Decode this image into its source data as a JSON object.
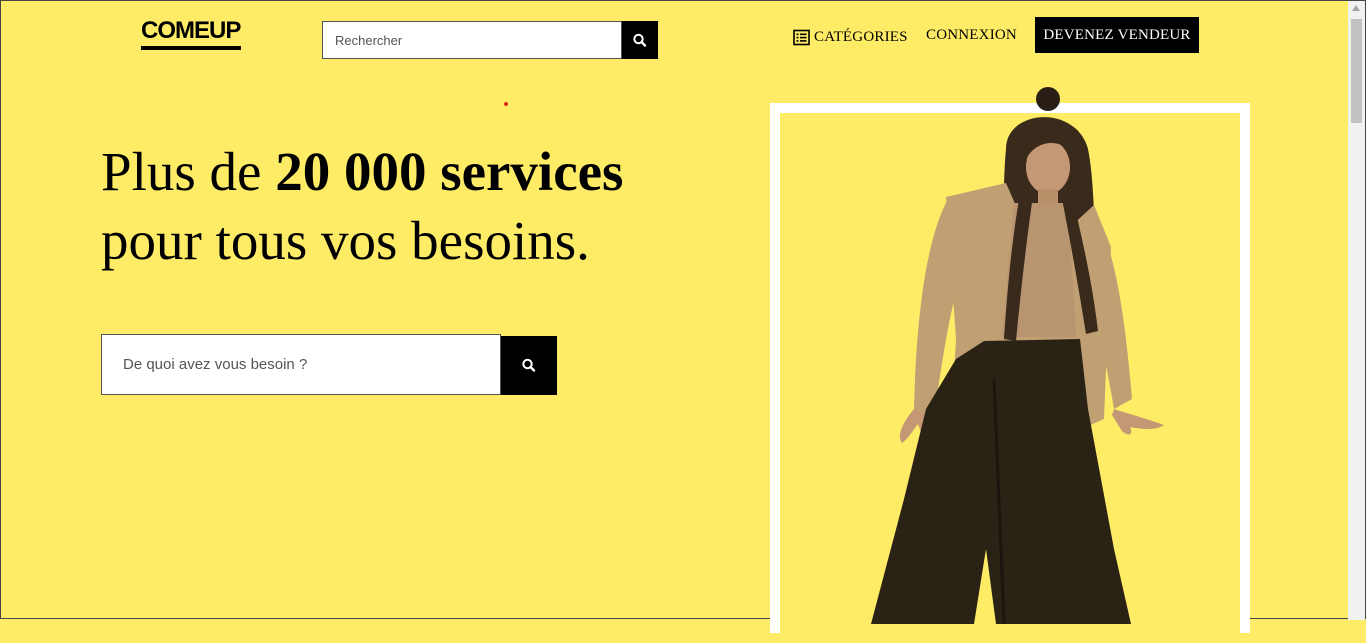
{
  "header": {
    "logo_text": "COMEUP",
    "search": {
      "placeholder": "Rechercher",
      "value": ""
    },
    "nav": {
      "categories_label": "CATÉGORIES",
      "login_label": "CONNEXION",
      "seller_label": "DEVENEZ VENDEUR"
    }
  },
  "hero": {
    "headline_prefix": "Plus de ",
    "headline_bold": "20 000 services",
    "headline_line2": "pour tous vos besoins.",
    "search": {
      "placeholder": "De quoi avez vous besoin ?",
      "value": ""
    }
  },
  "icons": {
    "header_search": "search-icon",
    "categories": "list-icon",
    "hero_search": "search-icon"
  },
  "colors": {
    "background": "#ffec66",
    "button_bg": "#000000",
    "button_text": "#ffffff",
    "frame": "#ffffff",
    "shirt": "#c0a073",
    "pants": "#2b2216"
  }
}
